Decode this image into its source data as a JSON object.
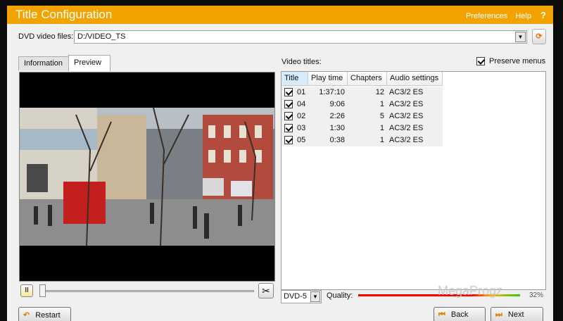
{
  "window": {
    "title": "Title Configuration",
    "menu": {
      "preferences": "Preferences",
      "help": "Help",
      "question": "?"
    }
  },
  "dvd_files": {
    "label": "DVD video files:",
    "value": "D:/VIDEO_TS",
    "dropdown_icon": "chevron-down-icon",
    "browse_icon": "refresh-icon"
  },
  "tabs": [
    {
      "label": "Information",
      "active": false
    },
    {
      "label": "Preview",
      "active": true
    }
  ],
  "player": {
    "pause_icon": "pause-icon",
    "cut_icon": "scissors-icon",
    "position": 0.0
  },
  "video_titles": {
    "label": "Video titles:",
    "preserve_menus": {
      "label": "Preserve menus",
      "checked": true
    },
    "columns": [
      "Title",
      "Play time",
      "Chapters",
      "Audio settings"
    ],
    "rows": [
      {
        "checked": true,
        "title": "01",
        "play_time": "1:37:10",
        "chapters": "12",
        "audio": "AC3/2 ES"
      },
      {
        "checked": true,
        "title": "04",
        "play_time": "9:06",
        "chapters": "1",
        "audio": "AC3/2 ES"
      },
      {
        "checked": true,
        "title": "02",
        "play_time": "2:26",
        "chapters": "5",
        "audio": "AC3/2 ES"
      },
      {
        "checked": true,
        "title": "03",
        "play_time": "1:30",
        "chapters": "1",
        "audio": "AC3/2 ES"
      },
      {
        "checked": true,
        "title": "05",
        "play_time": "0:38",
        "chapters": "1",
        "audio": "AC3/2 ES"
      }
    ]
  },
  "output": {
    "type": "DVD-5",
    "quality_label": "Quality:",
    "quality_pct": "32%",
    "watermark": "MegaProgz"
  },
  "buttons": {
    "restart": "Restart",
    "back": "Back",
    "next": "Next"
  },
  "colors": {
    "titlebar": "#f2a300",
    "accent": "#e08000"
  }
}
